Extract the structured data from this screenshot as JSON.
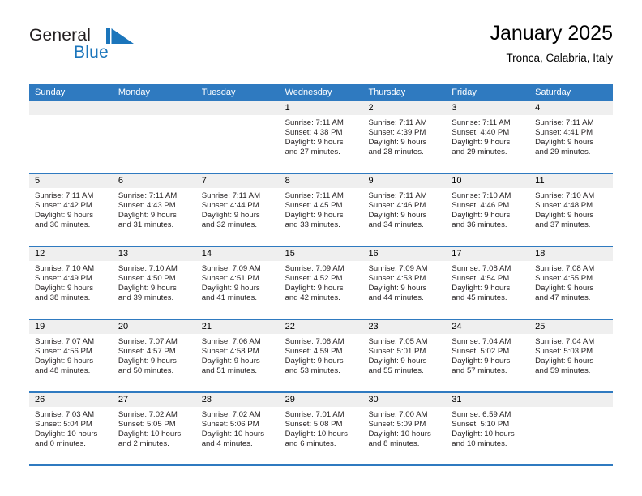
{
  "brand": {
    "name_part1": "General",
    "name_part2": "Blue",
    "mark": "triangle-logo",
    "color_primary": "#1b75bb",
    "color_text": "#231f20"
  },
  "header": {
    "title": "January 2025",
    "subtitle": "Tronca, Calabria, Italy"
  },
  "theme": {
    "header_blue": "#2f7ac0",
    "datenum_band": "#efefef"
  },
  "weekdays": [
    "Sunday",
    "Monday",
    "Tuesday",
    "Wednesday",
    "Thursday",
    "Friday",
    "Saturday"
  ],
  "weeks": [
    [
      {
        "day": "",
        "sunrise": "",
        "sunset": "",
        "daylight_line1": "",
        "daylight_line2": ""
      },
      {
        "day": "",
        "sunrise": "",
        "sunset": "",
        "daylight_line1": "",
        "daylight_line2": ""
      },
      {
        "day": "",
        "sunrise": "",
        "sunset": "",
        "daylight_line1": "",
        "daylight_line2": ""
      },
      {
        "day": "1",
        "sunrise": "Sunrise: 7:11 AM",
        "sunset": "Sunset: 4:38 PM",
        "daylight_line1": "Daylight: 9 hours",
        "daylight_line2": "and 27 minutes."
      },
      {
        "day": "2",
        "sunrise": "Sunrise: 7:11 AM",
        "sunset": "Sunset: 4:39 PM",
        "daylight_line1": "Daylight: 9 hours",
        "daylight_line2": "and 28 minutes."
      },
      {
        "day": "3",
        "sunrise": "Sunrise: 7:11 AM",
        "sunset": "Sunset: 4:40 PM",
        "daylight_line1": "Daylight: 9 hours",
        "daylight_line2": "and 29 minutes."
      },
      {
        "day": "4",
        "sunrise": "Sunrise: 7:11 AM",
        "sunset": "Sunset: 4:41 PM",
        "daylight_line1": "Daylight: 9 hours",
        "daylight_line2": "and 29 minutes."
      }
    ],
    [
      {
        "day": "5",
        "sunrise": "Sunrise: 7:11 AM",
        "sunset": "Sunset: 4:42 PM",
        "daylight_line1": "Daylight: 9 hours",
        "daylight_line2": "and 30 minutes."
      },
      {
        "day": "6",
        "sunrise": "Sunrise: 7:11 AM",
        "sunset": "Sunset: 4:43 PM",
        "daylight_line1": "Daylight: 9 hours",
        "daylight_line2": "and 31 minutes."
      },
      {
        "day": "7",
        "sunrise": "Sunrise: 7:11 AM",
        "sunset": "Sunset: 4:44 PM",
        "daylight_line1": "Daylight: 9 hours",
        "daylight_line2": "and 32 minutes."
      },
      {
        "day": "8",
        "sunrise": "Sunrise: 7:11 AM",
        "sunset": "Sunset: 4:45 PM",
        "daylight_line1": "Daylight: 9 hours",
        "daylight_line2": "and 33 minutes."
      },
      {
        "day": "9",
        "sunrise": "Sunrise: 7:11 AM",
        "sunset": "Sunset: 4:46 PM",
        "daylight_line1": "Daylight: 9 hours",
        "daylight_line2": "and 34 minutes."
      },
      {
        "day": "10",
        "sunrise": "Sunrise: 7:10 AM",
        "sunset": "Sunset: 4:46 PM",
        "daylight_line1": "Daylight: 9 hours",
        "daylight_line2": "and 36 minutes."
      },
      {
        "day": "11",
        "sunrise": "Sunrise: 7:10 AM",
        "sunset": "Sunset: 4:48 PM",
        "daylight_line1": "Daylight: 9 hours",
        "daylight_line2": "and 37 minutes."
      }
    ],
    [
      {
        "day": "12",
        "sunrise": "Sunrise: 7:10 AM",
        "sunset": "Sunset: 4:49 PM",
        "daylight_line1": "Daylight: 9 hours",
        "daylight_line2": "and 38 minutes."
      },
      {
        "day": "13",
        "sunrise": "Sunrise: 7:10 AM",
        "sunset": "Sunset: 4:50 PM",
        "daylight_line1": "Daylight: 9 hours",
        "daylight_line2": "and 39 minutes."
      },
      {
        "day": "14",
        "sunrise": "Sunrise: 7:09 AM",
        "sunset": "Sunset: 4:51 PM",
        "daylight_line1": "Daylight: 9 hours",
        "daylight_line2": "and 41 minutes."
      },
      {
        "day": "15",
        "sunrise": "Sunrise: 7:09 AM",
        "sunset": "Sunset: 4:52 PM",
        "daylight_line1": "Daylight: 9 hours",
        "daylight_line2": "and 42 minutes."
      },
      {
        "day": "16",
        "sunrise": "Sunrise: 7:09 AM",
        "sunset": "Sunset: 4:53 PM",
        "daylight_line1": "Daylight: 9 hours",
        "daylight_line2": "and 44 minutes."
      },
      {
        "day": "17",
        "sunrise": "Sunrise: 7:08 AM",
        "sunset": "Sunset: 4:54 PM",
        "daylight_line1": "Daylight: 9 hours",
        "daylight_line2": "and 45 minutes."
      },
      {
        "day": "18",
        "sunrise": "Sunrise: 7:08 AM",
        "sunset": "Sunset: 4:55 PM",
        "daylight_line1": "Daylight: 9 hours",
        "daylight_line2": "and 47 minutes."
      }
    ],
    [
      {
        "day": "19",
        "sunrise": "Sunrise: 7:07 AM",
        "sunset": "Sunset: 4:56 PM",
        "daylight_line1": "Daylight: 9 hours",
        "daylight_line2": "and 48 minutes."
      },
      {
        "day": "20",
        "sunrise": "Sunrise: 7:07 AM",
        "sunset": "Sunset: 4:57 PM",
        "daylight_line1": "Daylight: 9 hours",
        "daylight_line2": "and 50 minutes."
      },
      {
        "day": "21",
        "sunrise": "Sunrise: 7:06 AM",
        "sunset": "Sunset: 4:58 PM",
        "daylight_line1": "Daylight: 9 hours",
        "daylight_line2": "and 51 minutes."
      },
      {
        "day": "22",
        "sunrise": "Sunrise: 7:06 AM",
        "sunset": "Sunset: 4:59 PM",
        "daylight_line1": "Daylight: 9 hours",
        "daylight_line2": "and 53 minutes."
      },
      {
        "day": "23",
        "sunrise": "Sunrise: 7:05 AM",
        "sunset": "Sunset: 5:01 PM",
        "daylight_line1": "Daylight: 9 hours",
        "daylight_line2": "and 55 minutes."
      },
      {
        "day": "24",
        "sunrise": "Sunrise: 7:04 AM",
        "sunset": "Sunset: 5:02 PM",
        "daylight_line1": "Daylight: 9 hours",
        "daylight_line2": "and 57 minutes."
      },
      {
        "day": "25",
        "sunrise": "Sunrise: 7:04 AM",
        "sunset": "Sunset: 5:03 PM",
        "daylight_line1": "Daylight: 9 hours",
        "daylight_line2": "and 59 minutes."
      }
    ],
    [
      {
        "day": "26",
        "sunrise": "Sunrise: 7:03 AM",
        "sunset": "Sunset: 5:04 PM",
        "daylight_line1": "Daylight: 10 hours",
        "daylight_line2": "and 0 minutes."
      },
      {
        "day": "27",
        "sunrise": "Sunrise: 7:02 AM",
        "sunset": "Sunset: 5:05 PM",
        "daylight_line1": "Daylight: 10 hours",
        "daylight_line2": "and 2 minutes."
      },
      {
        "day": "28",
        "sunrise": "Sunrise: 7:02 AM",
        "sunset": "Sunset: 5:06 PM",
        "daylight_line1": "Daylight: 10 hours",
        "daylight_line2": "and 4 minutes."
      },
      {
        "day": "29",
        "sunrise": "Sunrise: 7:01 AM",
        "sunset": "Sunset: 5:08 PM",
        "daylight_line1": "Daylight: 10 hours",
        "daylight_line2": "and 6 minutes."
      },
      {
        "day": "30",
        "sunrise": "Sunrise: 7:00 AM",
        "sunset": "Sunset: 5:09 PM",
        "daylight_line1": "Daylight: 10 hours",
        "daylight_line2": "and 8 minutes."
      },
      {
        "day": "31",
        "sunrise": "Sunrise: 6:59 AM",
        "sunset": "Sunset: 5:10 PM",
        "daylight_line1": "Daylight: 10 hours",
        "daylight_line2": "and 10 minutes."
      },
      {
        "day": "",
        "sunrise": "",
        "sunset": "",
        "daylight_line1": "",
        "daylight_line2": ""
      }
    ]
  ]
}
